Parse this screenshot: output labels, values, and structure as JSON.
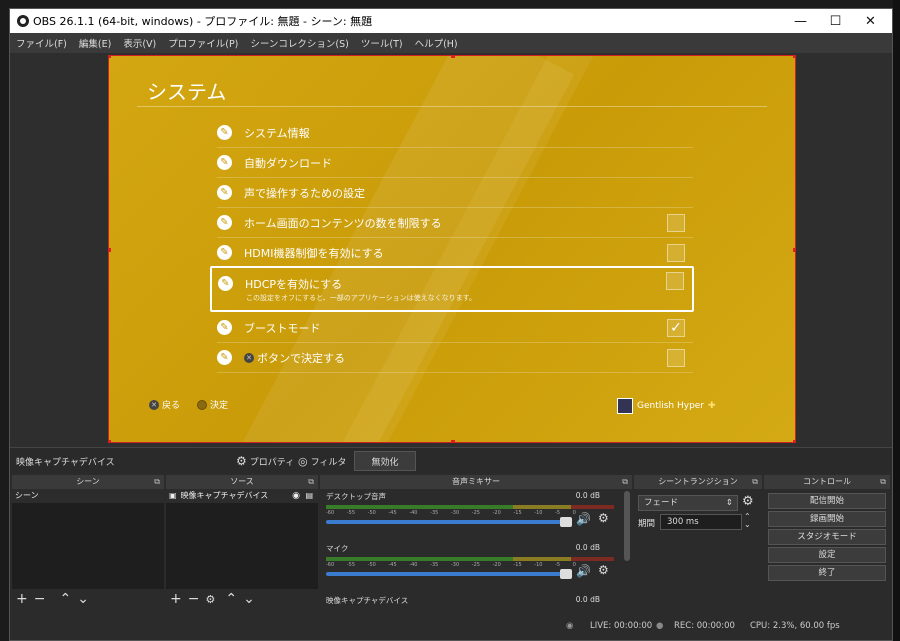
{
  "window": {
    "title": "OBS 26.1.1 (64-bit, windows) - プロファイル: 無題 - シーン: 無題",
    "minimize_glyph": "—",
    "maximize_glyph": "☐",
    "close_glyph": "✕"
  },
  "menu": [
    "ファイル(F)",
    "編集(E)",
    "表示(V)",
    "プロファイル(P)",
    "シーンコレクション(S)",
    "ツール(T)",
    "ヘルプ(H)"
  ],
  "preview": {
    "heading": "システム",
    "items": [
      {
        "label": "システム情報",
        "check": ""
      },
      {
        "label": "自動ダウンロード",
        "check": ""
      },
      {
        "label": "声で操作するための設定",
        "check": ""
      },
      {
        "label": "ホーム画面のコンテンツの数を制限する",
        "check": ""
      },
      {
        "label": "HDMI機器制御を有効にする",
        "check": ""
      },
      {
        "label": "HDCPを有効にする",
        "check": "",
        "sub": "この設定をオフにすると、一部のアプリケーションは使えなくなります。"
      },
      {
        "label": "ブーストモード",
        "check": "✓"
      },
      {
        "label": "ボタンで決定する",
        "check": "",
        "prefix_icon": "cross-button"
      }
    ],
    "back_label": "戻る",
    "enter_label": "決定",
    "user_name": "Gentlish Hyper",
    "plus_glyph": "✚"
  },
  "source_toolbar": {
    "source_name": "映像キャプチャデバイス",
    "properties_label": "プロパティ",
    "filters_label": "フィルタ",
    "deactivate_label": "無効化"
  },
  "docks": {
    "scenes": {
      "title": "シーン",
      "items": [
        "シーン"
      ]
    },
    "sources": {
      "title": "ソース",
      "items": [
        "映像キャプチャデバイス"
      ]
    },
    "mixer": {
      "title": "音声ミキサー",
      "channels": [
        {
          "name": "デスクトップ音声",
          "db": "0.0 dB"
        },
        {
          "name": "マイク",
          "db": "0.0 dB"
        },
        {
          "name": "映像キャプチャデバイス",
          "db": "0.0 dB"
        }
      ],
      "ticks": [
        "-60",
        "-55",
        "-50",
        "-45",
        "-40",
        "-35",
        "-30",
        "-25",
        "-20",
        "-15",
        "-10",
        "-5",
        "0"
      ]
    },
    "transitions": {
      "title": "シーントランジション",
      "transition": "フェード",
      "duration_label": "期間",
      "duration": "300 ms"
    },
    "controls": {
      "title": "コントロール",
      "buttons": [
        "配信開始",
        "録画開始",
        "スタジオモード",
        "設定",
        "終了"
      ]
    }
  },
  "status": {
    "live": "LIVE: 00:00:00",
    "rec": "REC: 00:00:00",
    "cpu": "CPU: 2.3%, 60.00 fps"
  }
}
